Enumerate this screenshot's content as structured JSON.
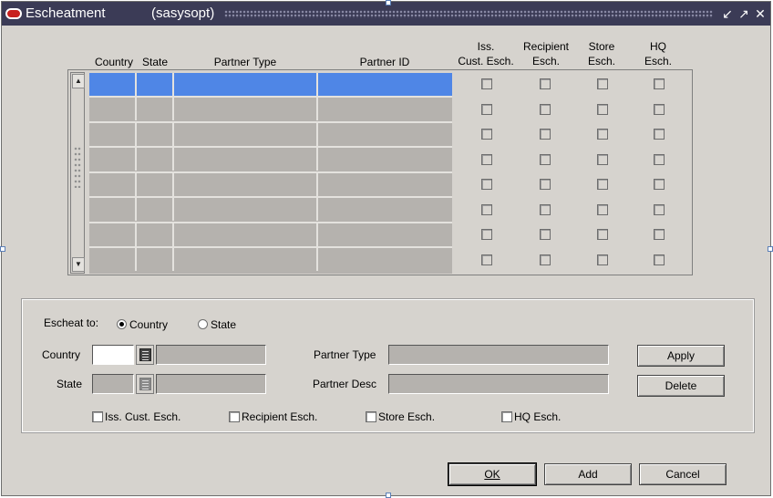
{
  "window": {
    "title": "Escheatment",
    "user": "(sasysopt)"
  },
  "table": {
    "headers": {
      "country": "Country",
      "state": "State",
      "partner_type": "Partner Type",
      "partner_id": "Partner ID",
      "iss_cust_1": "Iss.",
      "iss_cust_2": "Cust. Esch.",
      "recipient_1": "Recipient",
      "recipient_2": "Esch.",
      "store_1": "Store",
      "store_2": "Esch.",
      "hq_1": "HQ",
      "hq_2": "Esch."
    },
    "row_count": 8,
    "selected_row": 0
  },
  "form": {
    "escheat_to_label": "Escheat to:",
    "radio_country": "Country",
    "radio_state": "State",
    "selected_radio": "country",
    "country_label": "Country",
    "state_label": "State",
    "partner_type_label": "Partner Type",
    "partner_desc_label": "Partner Desc",
    "country_value": "",
    "state_value": "",
    "partner_type_value": "",
    "partner_desc_value": "",
    "apply_label": "Apply",
    "delete_label": "Delete",
    "chk_iss": "Iss. Cust. Esch.",
    "chk_recipient": "Recipient Esch.",
    "chk_store": "Store Esch.",
    "chk_hq": "HQ Esch."
  },
  "footer": {
    "ok_label": "OK",
    "add_label": "Add",
    "cancel_label": "Cancel"
  }
}
